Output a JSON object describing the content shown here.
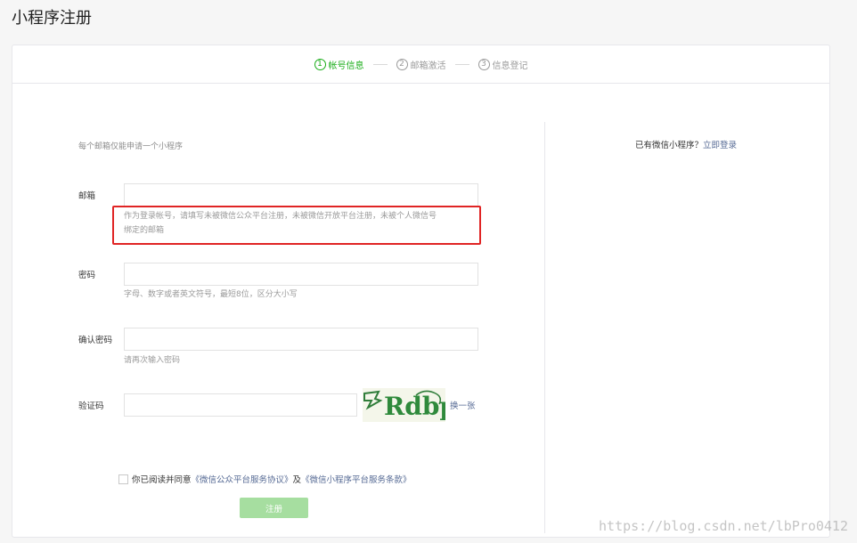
{
  "page": {
    "title": "小程序注册"
  },
  "steps": [
    {
      "num": "1",
      "label": "帐号信息"
    },
    {
      "num": "2",
      "label": "邮箱激活"
    },
    {
      "num": "3",
      "label": "信息登记"
    }
  ],
  "form": {
    "tip": "每个邮箱仅能申请一个小程序",
    "email": {
      "label": "邮箱",
      "value": "",
      "hint_line1": "作为登录帐号，请填写未被微信公众平台注册，未被微信开放平台注册，未被个人微信号",
      "hint_line2": "绑定的邮箱"
    },
    "password": {
      "label": "密码",
      "value": "",
      "hint": "字母、数字或者英文符号，最短8位，区分大小写"
    },
    "confirm": {
      "label": "确认密码",
      "value": "",
      "hint": "请再次输入密码"
    },
    "captcha": {
      "label": "验证码",
      "value": "",
      "image_text": "Rdbp",
      "refresh": "换一张"
    },
    "agree": {
      "prefix": "你已阅读并同意",
      "agreement1": "《微信公众平台服务协议》",
      "and": "及",
      "agreement2": "《微信小程序平台服务条款》"
    },
    "submit_label": "注册"
  },
  "side": {
    "text": "已有微信小程序？",
    "link": "立即登录"
  },
  "watermark": "https://blog.csdn.net/lbPro0412",
  "colors": {
    "accent": "#1aad19",
    "link": "#576b95",
    "highlight": "#e02424",
    "button_disabled": "#a6dea0"
  }
}
